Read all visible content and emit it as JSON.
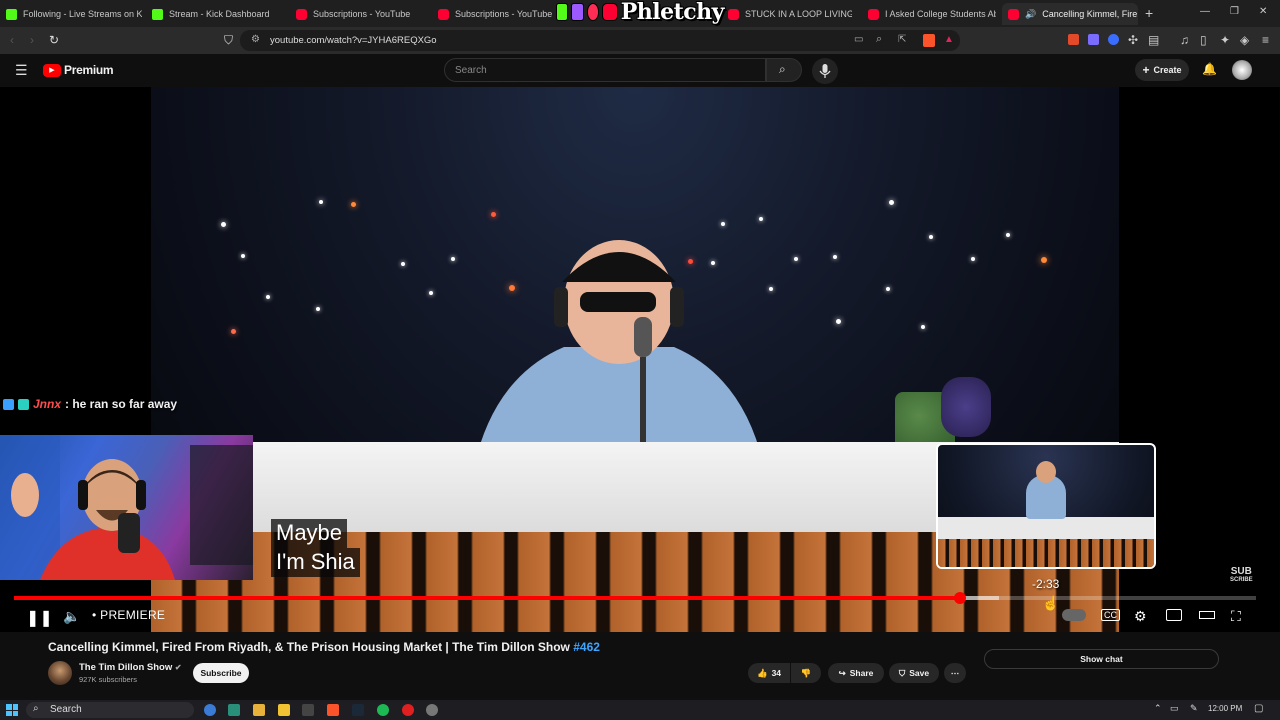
{
  "browser": {
    "tabs": [
      {
        "label": "Following - Live Streams on Ki",
        "icon": "kick-favicon",
        "active": false
      },
      {
        "label": "Stream - Kick Dashboard",
        "icon": "kick-favicon",
        "active": false
      },
      {
        "label": "Subscriptions - YouTube",
        "icon": "youtube-favicon",
        "active": false
      },
      {
        "label": "Subscriptions - YouTube",
        "icon": "youtube-favicon",
        "active": false
      },
      {
        "label": "STUCK IN A LOOP LIVING IN A",
        "icon": "youtube-favicon",
        "active": false
      },
      {
        "label": "I Asked College Students Abou",
        "icon": "youtube-favicon",
        "active": false
      },
      {
        "label": "Cancelling Kimmel, Fire",
        "icon": "youtube-favicon",
        "active": true,
        "audio": true
      }
    ],
    "url": "youtube.com/watch?v=JYHA6REQXGo"
  },
  "overlay": {
    "logo_text": "Phletchy",
    "chip_colors": [
      "#53fc18",
      "#9b59ff",
      "#ff2d55",
      "#ff0033"
    ],
    "chat": {
      "user": "Jnnx",
      "message": ": he ran so far away",
      "user_color": "#ff4d4d"
    }
  },
  "youtube": {
    "logo_text": "Premium",
    "search_placeholder": "Search",
    "create_label": "Create"
  },
  "video": {
    "caption_lines": [
      "Maybe",
      "I'm Shia"
    ],
    "preview_time": "-2:33",
    "progress_played": 0.762,
    "progress_buffered": 0.793,
    "premiere_label": "PREMIERE",
    "sub_scribe": [
      "SUB",
      "SCRIBE"
    ]
  },
  "details": {
    "title": "Cancelling Kimmel, Fired From Riyadh, & The Prison Housing Market | The Tim Dillon Show",
    "title_tag": "#462",
    "channel_name": "The Tim Dillon Show",
    "subscribers": "927K subscribers",
    "subscribe_label": "Subscribe",
    "like_count": "34",
    "share_label": "Share",
    "save_label": "Save",
    "show_chat_label": "Show chat"
  },
  "taskbar": {
    "search_label": "Search",
    "time": "12:00 PM"
  },
  "colors": {
    "accent_red": "#ff0000",
    "link_blue": "#3ea6ff",
    "kick_green": "#53fc18"
  }
}
